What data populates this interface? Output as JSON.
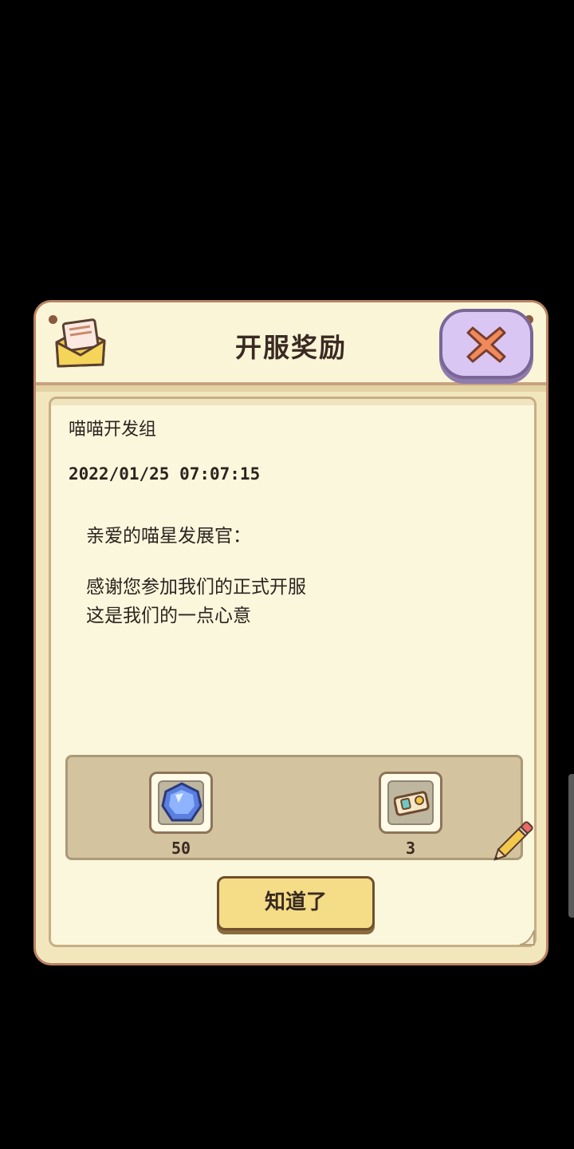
{
  "dialog": {
    "title": "开服奖励",
    "close_icon": "close-x-icon",
    "mail_icon": "open-envelope-icon"
  },
  "mail": {
    "sender": "喵喵开发组",
    "timestamp": "2022/01/25 07:07:15",
    "greeting": "亲爱的喵星发展官：",
    "body_lines": [
      "感谢您参加我们的正式开服",
      "这是我们的一点心意"
    ]
  },
  "rewards": [
    {
      "icon": "blue-gem-icon",
      "count": "50"
    },
    {
      "icon": "ticket-icon",
      "count": "3"
    }
  ],
  "confirm_button": {
    "label": "知道了"
  },
  "colors": {
    "frame": "#b98363",
    "paper": "#fbf7dc",
    "close_bg": "#d9c6f2",
    "close_x": "#f08a5a",
    "button_bg": "#f4dd86"
  }
}
